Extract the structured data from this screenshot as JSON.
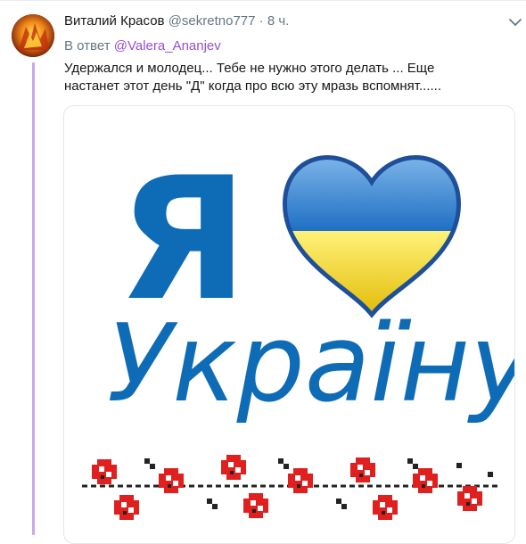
{
  "tweet": {
    "author_name": "Виталий Красов",
    "author_handle": "@sekretno777",
    "separator": "·",
    "time_ago": "8 ч.",
    "reply_prefix": "В ответ",
    "reply_handle": "@Valera_Ananjev",
    "text": "Удержался и молодец... Тебе не нужно этого делать ... Еще\nнастанет этот день \"Д\" когда про всю эту мразь вспомнят......"
  },
  "image": {
    "line1": "Я",
    "line2": "Україну",
    "colors": {
      "text_blue": "#0e6bb6",
      "heart_blue": "#2d86d6",
      "heart_yellow": "#f7d21a",
      "embroidery_red": "#e0201e",
      "embroidery_black": "#222222"
    }
  },
  "icons": {
    "caret": "chevron-down-icon",
    "avatar": "avatar-image"
  }
}
